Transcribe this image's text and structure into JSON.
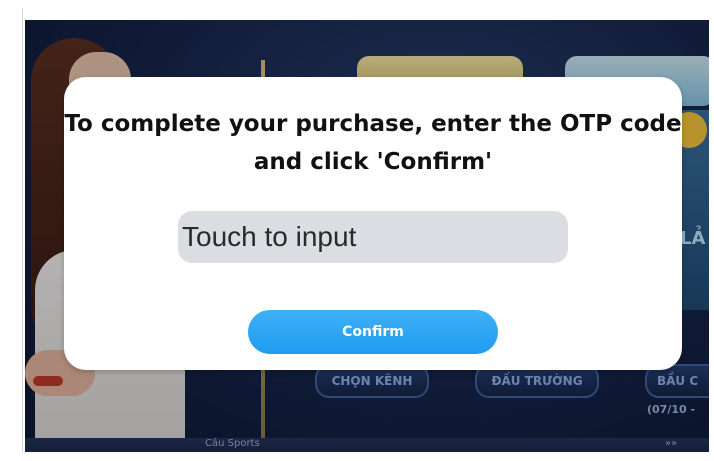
{
  "background": {
    "menu_buttons": [
      "CHỌN KÊNH",
      "ĐẤU TRƯỜNG",
      "BẦU C"
    ],
    "date_text": "(07/10 -",
    "side_text": "LẢ",
    "ticker_text": "Câu Sports",
    "ticker_arrows": "»»"
  },
  "dialog": {
    "message": "To complete your purchase, enter the OTP code and click 'Confirm'",
    "otp_input": {
      "placeholder": "Touch to input",
      "value": ""
    },
    "confirm_label": "Confirm"
  },
  "colors": {
    "confirm_button": "#2aa6f2",
    "input_background": "#dcdde3",
    "dialog_background": "#ffffff"
  }
}
